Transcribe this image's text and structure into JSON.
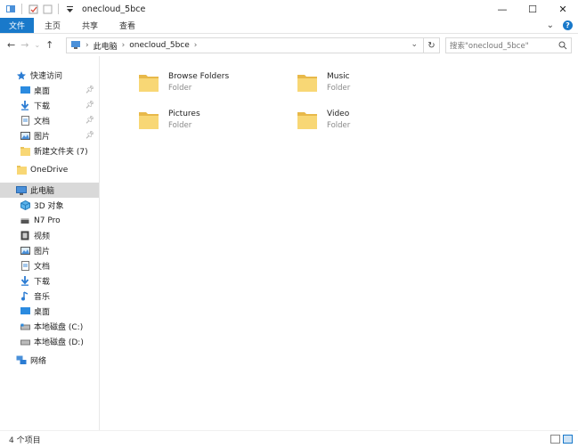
{
  "window": {
    "title": "onecloud_5bce",
    "controls": {
      "minimize": "—",
      "maximize": "☐",
      "close": "✕"
    }
  },
  "ribbon": {
    "tabs": [
      "文件",
      "主页",
      "共享",
      "查看"
    ],
    "help": "?",
    "expand": "⌄"
  },
  "navigation": {
    "back": "←",
    "forward": "→",
    "recent": "⌄",
    "up": "↑"
  },
  "address": {
    "breadcrumbs": [
      "此电脑",
      "onecloud_5bce"
    ],
    "separator": "›"
  },
  "search": {
    "placeholder": "搜索\"onecloud_5bce\""
  },
  "sidebar": {
    "quick_access": "快速访问",
    "quick_items": [
      {
        "label": "桌面",
        "icon": "desktop-icon",
        "pinned": true
      },
      {
        "label": "下载",
        "icon": "download-icon",
        "pinned": true
      },
      {
        "label": "文档",
        "icon": "document-icon",
        "pinned": true
      },
      {
        "label": "图片",
        "icon": "picture-icon",
        "pinned": true
      },
      {
        "label": "新建文件夹 (7)",
        "icon": "folder-icon",
        "pinned": false
      }
    ],
    "onedrive": "OneDrive",
    "this_pc": "此电脑",
    "pc_items": [
      {
        "label": "3D 对象",
        "icon": "3d-objects-icon"
      },
      {
        "label": "N7 Pro",
        "icon": "device-icon"
      },
      {
        "label": "视频",
        "icon": "video-icon"
      },
      {
        "label": "图片",
        "icon": "picture-icon"
      },
      {
        "label": "文档",
        "icon": "document-icon"
      },
      {
        "label": "下载",
        "icon": "download-icon"
      },
      {
        "label": "音乐",
        "icon": "music-icon"
      },
      {
        "label": "桌面",
        "icon": "desktop-icon"
      },
      {
        "label": "本地磁盘 (C:)",
        "icon": "drive-icon"
      },
      {
        "label": "本地磁盘 (D:)",
        "icon": "drive-icon"
      }
    ],
    "network": "网络"
  },
  "folders": [
    {
      "name": "Browse Folders",
      "type": "Folder"
    },
    {
      "name": "Music",
      "type": "Folder"
    },
    {
      "name": "Pictures",
      "type": "Folder"
    },
    {
      "name": "Video",
      "type": "Folder"
    }
  ],
  "status": {
    "item_count": "4 个项目"
  },
  "colors": {
    "accent": "#1979ca",
    "folder": "#f8d775",
    "selected": "#d9d9d9"
  }
}
